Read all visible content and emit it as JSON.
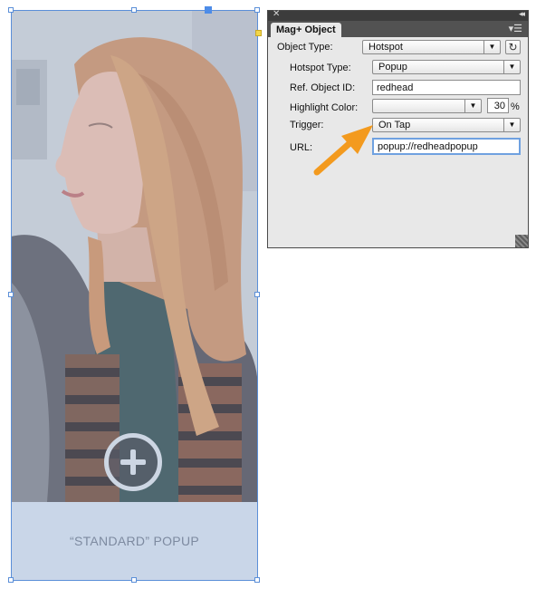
{
  "canvas": {
    "caption": "“STANDARD” POPUP"
  },
  "panel": {
    "title": "Mag+ Object",
    "fields": {
      "object_type": {
        "label": "Object Type:",
        "value": "Hotspot"
      },
      "hotspot_type": {
        "label": "Hotspot Type:",
        "value": "Popup"
      },
      "ref_object_id": {
        "label": "Ref. Object ID:",
        "value": "redhead"
      },
      "highlight_color": {
        "label": "Highlight Color:",
        "value": "",
        "opacity": "30",
        "unit": "%"
      },
      "trigger": {
        "label": "Trigger:",
        "value": "On Tap"
      },
      "url": {
        "label": "URL:",
        "value": "popup://redheadpopup"
      }
    }
  },
  "colors": {
    "selection": "#5b8fd8",
    "annotation_arrow": "#f39a1e",
    "caption_band": "#c9d6e8"
  },
  "icons": {
    "plus": "plus-circle-icon",
    "close": "close-icon",
    "collapse": "collapse-icon",
    "menu": "panel-menu-icon",
    "refresh": "refresh-icon",
    "arrow": "annotation-arrow-icon"
  }
}
